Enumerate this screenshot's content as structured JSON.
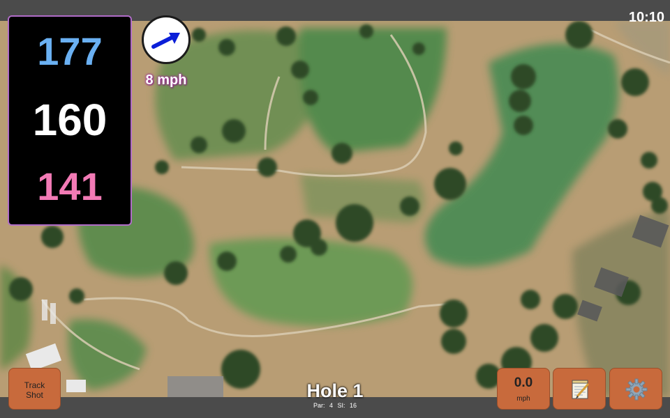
{
  "status_bar": {
    "time": "10:10"
  },
  "distances": {
    "back": "177",
    "middle": "160",
    "front": "141"
  },
  "wind": {
    "speed_label": "8 mph",
    "direction_icon": "arrow-right-up-icon"
  },
  "buttons": {
    "track_shot_line1": "Track",
    "track_shot_line2": "Shot",
    "speed_value": "0.0",
    "speed_unit": "mph",
    "notes_icon": "notepad-icon",
    "settings_icon": "gear-icon"
  },
  "hole": {
    "title": "Hole 1",
    "par_label": "Par: 4",
    "si_label": "SI: 16"
  },
  "colors": {
    "back_distance": "#6ab0f2",
    "middle_distance": "#ffffff",
    "front_distance": "#f27ab5",
    "button_fill": "#c86a3c",
    "panel_border": "#b06cc8"
  }
}
